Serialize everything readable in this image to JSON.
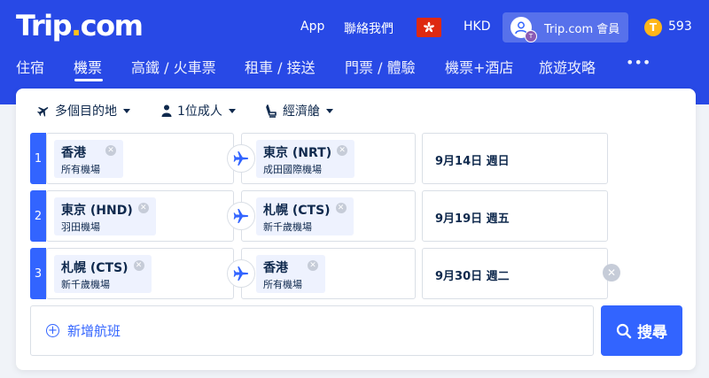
{
  "header": {
    "logo_main": "Trip",
    "logo_dot": ".",
    "logo_com": "com",
    "app": "App",
    "contact": "聯絡我們",
    "currency": "HKD",
    "member": "Trip.com 會員",
    "member_badge": "T",
    "coin_symbol": "T",
    "points": "593"
  },
  "nav": [
    "住宿",
    "機票",
    "高鐵 / 火車票",
    "租車 / 接送",
    "門票 / 體驗",
    "機票+酒店",
    "旅遊攻略",
    "•••"
  ],
  "options": {
    "trip_type": "多個目的地",
    "passengers": "1位成人",
    "cabin": "經濟艙"
  },
  "segments": [
    {
      "num": "1",
      "from_city": "香港",
      "from_airport": "所有機場",
      "to_city": "東京 (NRT)",
      "to_airport": "成田國際機場",
      "date": "9月14日 週日"
    },
    {
      "num": "2",
      "from_city": "東京 (HND)",
      "from_airport": "羽田機場",
      "to_city": "札幌 (CTS)",
      "to_airport": "新千歲機場",
      "date": "9月19日 週五"
    },
    {
      "num": "3",
      "from_city": "札幌 (CTS)",
      "from_airport": "新千歲機場",
      "to_city": "香港",
      "to_airport": "所有機場",
      "date": "9月30日 週二"
    }
  ],
  "add_flight": "新增航班",
  "search": "搜尋",
  "colors": {
    "brand": "#2849e6",
    "accent": "#3264ff",
    "coin": "#ffb619"
  }
}
